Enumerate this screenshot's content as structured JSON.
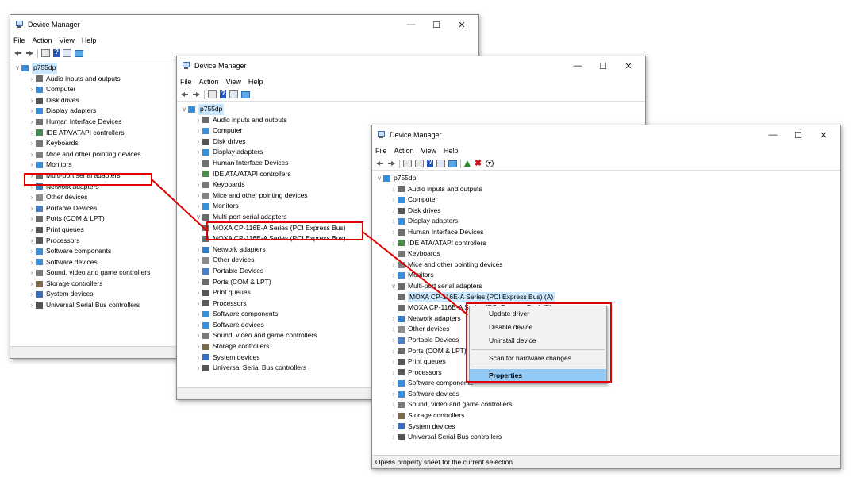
{
  "window_title": "Device Manager",
  "menu": [
    "File",
    "Action",
    "View",
    "Help"
  ],
  "root": "p755dp",
  "icon_colors": {
    "audio": "#6a6a6a",
    "computer": "#3a8fdb",
    "disk": "#555555",
    "display": "#3a8fdb",
    "hid": "#6f6f6f",
    "ide": "#4b8a4b",
    "keyboard": "#777777",
    "mouse": "#808080",
    "monitor": "#3a8fdb",
    "serial": "#6a6a6a",
    "network": "#2f7fcf",
    "other": "#8a8a8a",
    "portable": "#4c7fc9",
    "ports": "#6a6a6a",
    "print": "#555555",
    "processor": "#5a5a5a",
    "software": "#3a8fdb",
    "sound": "#7a7a7a",
    "storage": "#7d6a4d",
    "system": "#3a6fbf",
    "usb": "#555555"
  },
  "win1": {
    "items": [
      {
        "label": "Audio inputs and outputs",
        "icon": "audio"
      },
      {
        "label": "Computer",
        "icon": "computer"
      },
      {
        "label": "Disk drives",
        "icon": "disk"
      },
      {
        "label": "Display adapters",
        "icon": "display"
      },
      {
        "label": "Human Interface Devices",
        "icon": "hid"
      },
      {
        "label": "IDE ATA/ATAPI controllers",
        "icon": "ide"
      },
      {
        "label": "Keyboards",
        "icon": "keyboard"
      },
      {
        "label": "Mice and other pointing devices",
        "icon": "mouse"
      },
      {
        "label": "Monitors",
        "icon": "monitor"
      },
      {
        "label": "Multi-port serial adapters",
        "icon": "serial"
      },
      {
        "label": "Network adapters",
        "icon": "network"
      },
      {
        "label": "Other devices",
        "icon": "other"
      },
      {
        "label": "Portable Devices",
        "icon": "portable"
      },
      {
        "label": "Ports (COM & LPT)",
        "icon": "ports"
      },
      {
        "label": "Print queues",
        "icon": "print"
      },
      {
        "label": "Processors",
        "icon": "processor"
      },
      {
        "label": "Software components",
        "icon": "software"
      },
      {
        "label": "Software devices",
        "icon": "software"
      },
      {
        "label": "Sound, video and game controllers",
        "icon": "sound"
      },
      {
        "label": "Storage controllers",
        "icon": "storage"
      },
      {
        "label": "System devices",
        "icon": "system"
      },
      {
        "label": "Universal Serial Bus controllers",
        "icon": "usb"
      }
    ]
  },
  "win2": {
    "items": [
      {
        "label": "Audio inputs and outputs",
        "icon": "audio"
      },
      {
        "label": "Computer",
        "icon": "computer"
      },
      {
        "label": "Disk drives",
        "icon": "disk"
      },
      {
        "label": "Display adapters",
        "icon": "display"
      },
      {
        "label": "Human Interface Devices",
        "icon": "hid"
      },
      {
        "label": "IDE ATA/ATAPI controllers",
        "icon": "ide"
      },
      {
        "label": "Keyboards",
        "icon": "keyboard"
      },
      {
        "label": "Mice and other pointing devices",
        "icon": "mouse"
      },
      {
        "label": "Monitors",
        "icon": "monitor"
      },
      {
        "label": "Multi-port serial adapters",
        "icon": "serial",
        "expanded": true
      },
      {
        "label": "MOXA CP-116E-A Series (PCI Express Bus)",
        "icon": "serial",
        "child": true,
        "highlight": true
      },
      {
        "label": "MOXA CP-116E-A Series (PCI Express Bus)",
        "icon": "serial",
        "child": true
      },
      {
        "label": "Network adapters",
        "icon": "network"
      },
      {
        "label": "Other devices",
        "icon": "other"
      },
      {
        "label": "Portable Devices",
        "icon": "portable"
      },
      {
        "label": "Ports (COM & LPT)",
        "icon": "ports"
      },
      {
        "label": "Print queues",
        "icon": "print"
      },
      {
        "label": "Processors",
        "icon": "processor"
      },
      {
        "label": "Software components",
        "icon": "software"
      },
      {
        "label": "Software devices",
        "icon": "software"
      },
      {
        "label": "Sound, video and game controllers",
        "icon": "sound"
      },
      {
        "label": "Storage controllers",
        "icon": "storage"
      },
      {
        "label": "System devices",
        "icon": "system"
      },
      {
        "label": "Universal Serial Bus controllers",
        "icon": "usb"
      }
    ]
  },
  "win3": {
    "items": [
      {
        "label": "Audio inputs and outputs",
        "icon": "audio"
      },
      {
        "label": "Computer",
        "icon": "computer"
      },
      {
        "label": "Disk drives",
        "icon": "disk"
      },
      {
        "label": "Display adapters",
        "icon": "display"
      },
      {
        "label": "Human Interface Devices",
        "icon": "hid"
      },
      {
        "label": "IDE ATA/ATAPI controllers",
        "icon": "ide"
      },
      {
        "label": "Keyboards",
        "icon": "keyboard"
      },
      {
        "label": "Mice and other pointing devices",
        "icon": "mouse"
      },
      {
        "label": "Monitors",
        "icon": "monitor"
      },
      {
        "label": "Multi-port serial adapters",
        "icon": "serial",
        "expanded": true
      },
      {
        "label": "MOXA CP-116E-A Series (PCI Express Bus) (A)",
        "icon": "serial",
        "child": true,
        "selected": true
      },
      {
        "label": "MOXA CP-116E-A Series (PCI Express Bus) (B)",
        "icon": "serial",
        "child": true
      },
      {
        "label": "Network adapters",
        "icon": "network"
      },
      {
        "label": "Other devices",
        "icon": "other"
      },
      {
        "label": "Portable Devices",
        "icon": "portable"
      },
      {
        "label": "Ports (COM & LPT)",
        "icon": "ports"
      },
      {
        "label": "Print queues",
        "icon": "print"
      },
      {
        "label": "Processors",
        "icon": "processor"
      },
      {
        "label": "Software components",
        "icon": "software"
      },
      {
        "label": "Software devices",
        "icon": "software"
      },
      {
        "label": "Sound, video and game controllers",
        "icon": "sound"
      },
      {
        "label": "Storage controllers",
        "icon": "storage"
      },
      {
        "label": "System devices",
        "icon": "system"
      },
      {
        "label": "Universal Serial Bus controllers",
        "icon": "usb"
      }
    ],
    "status": "Opens property sheet for the current selection."
  },
  "context_menu": {
    "items": [
      {
        "label": "Update driver"
      },
      {
        "label": "Disable device"
      },
      {
        "label": "Uninstall device"
      },
      {
        "separator": true
      },
      {
        "label": "Scan for hardware changes"
      },
      {
        "separator": true
      },
      {
        "label": "Properties",
        "selected": true
      }
    ]
  },
  "highlight_color": "#e00000"
}
